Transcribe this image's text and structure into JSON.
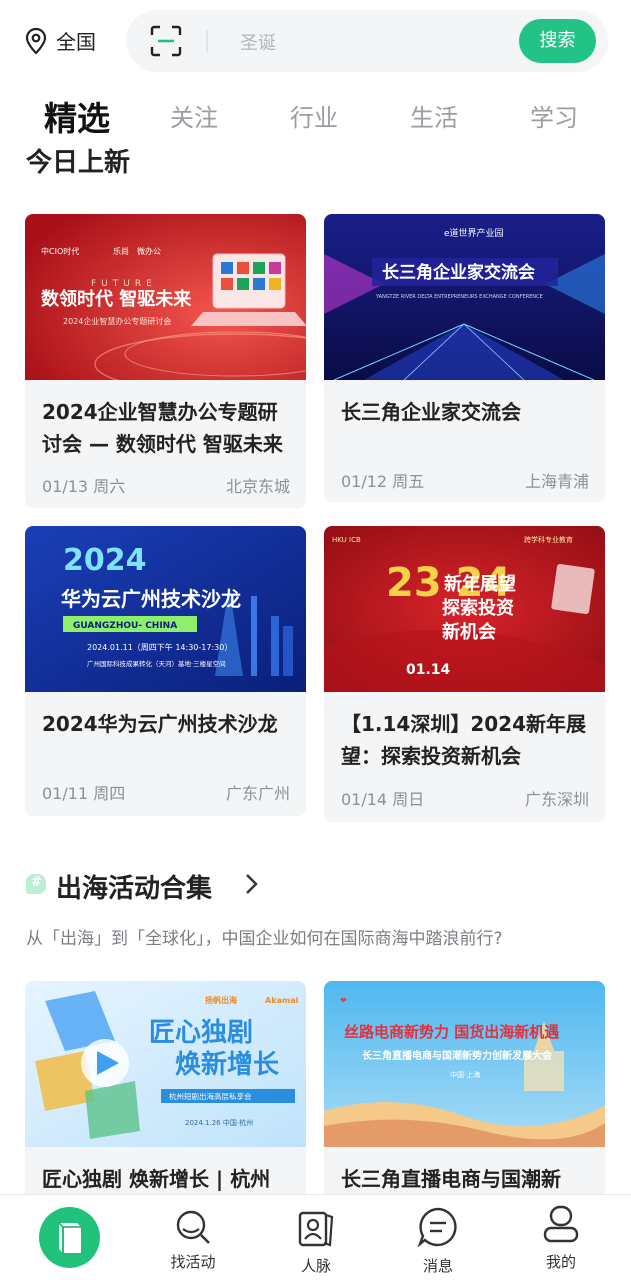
{
  "location": {
    "label": "全国",
    "icon": "location-pin-icon"
  },
  "search": {
    "placeholder": "圣诞",
    "button_label": "搜索",
    "scan_icon": "scan-icon"
  },
  "tabs": [
    {
      "label": "精选",
      "active": true
    },
    {
      "label": "关注",
      "active": false
    },
    {
      "label": "行业",
      "active": false
    },
    {
      "label": "生活",
      "active": false
    },
    {
      "label": "学习",
      "active": false
    }
  ],
  "section": {
    "title": "今日上新"
  },
  "events": [
    {
      "title": "2024企业智慧办公专题研讨会 — 数领时代 智驱未来",
      "date": "01/13 周六",
      "location": "北京东城",
      "banner": {
        "headline": "数领时代 智驱未来",
        "sub": "2024企业智慧办公专题研讨会",
        "mark": "FUTURE",
        "logos": [
          "中CIO时代",
          "乐尚",
          "微办公"
        ]
      }
    },
    {
      "title": "长三角企业家交流会",
      "date": "01/12 周五",
      "location": "上海青浦",
      "banner": {
        "headline": "长三角企业家交流会",
        "sub": "YANGTZE RIVER DELTA ENTREPRENEURS EXCHANGE CONFERENCE",
        "logos": [
          "e道世界产业园"
        ]
      }
    },
    {
      "title": "2024华为云广州技术沙龙",
      "date": "01/11 周四",
      "location": "广东广州",
      "banner": {
        "year": "2024",
        "headline": "华为云广州技术沙龙",
        "tag": "GUANGZHOU- CHINA",
        "time": "2024.01.11（周四下午 14:30-17:30）",
        "venue": "广州国际科技成果转化（天河）基地·三楼星空间"
      }
    },
    {
      "title": "【1.14深圳】2024新年展望：探索投资新机会",
      "date": "01/14 周日",
      "location": "广东深圳",
      "banner": {
        "big": "23 24",
        "line1": "新年展望",
        "line2": "探索投资",
        "line3": "新机会",
        "day": "01.14",
        "org": "HKU ICB",
        "tagline": "跨学科专业教育"
      }
    }
  ],
  "collection": {
    "title": "出海活动合集",
    "subtitle": "从「出海」到「全球化」，中国企业如何在国际商海中踏浪前行?",
    "cards": [
      {
        "title": "匠心独剧 焕新增长 | 杭州",
        "banner": {
          "line1": "匠心独剧",
          "line2": "焕新增长",
          "sub": "杭州短剧出海高层私享会",
          "date": "2024.1.26 中国·杭州",
          "logos": [
            "扬帆出海",
            "Akamai"
          ]
        }
      },
      {
        "title": "长三角直播电商与国潮新",
        "banner": {
          "line1": "丝路电商新势力 国货出海新机遇",
          "line2": "长三角直播电商与国潮新势力创新发展大会",
          "city": "中国·上海"
        }
      }
    ]
  },
  "bottom_nav": [
    {
      "label": "",
      "icon": "home-book-icon",
      "active": true
    },
    {
      "label": "找活动",
      "icon": "search-activity-icon"
    },
    {
      "label": "人脉",
      "icon": "contacts-icon"
    },
    {
      "label": "消息",
      "icon": "message-icon"
    },
    {
      "label": "我的",
      "icon": "profile-icon"
    }
  ]
}
